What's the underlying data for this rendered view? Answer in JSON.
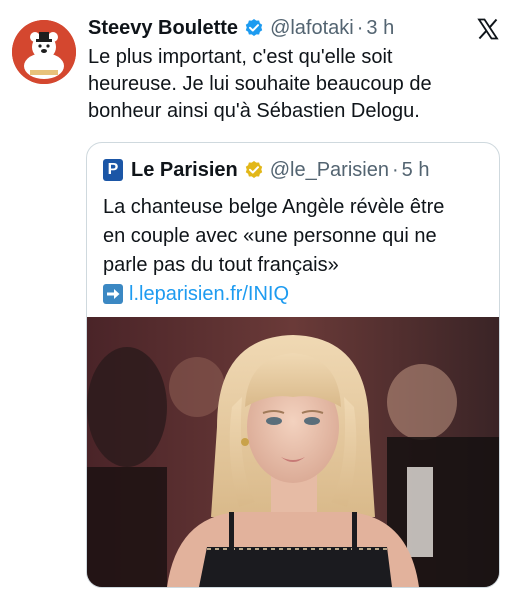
{
  "tweet": {
    "author_name": "Steevy Boulette",
    "handle": "@lafotaki",
    "separator": "·",
    "time": "3 h",
    "lines": [
      "Le plus important,  c'est qu'elle soit",
      "heureuse. Je lui souhaite beaucoup de",
      "bonheur ainsi qu'à Sébastien Delogu."
    ]
  },
  "quote": {
    "logo_letter": "P",
    "author_name": "Le Parisien",
    "handle": "@le_Parisien",
    "separator": "·",
    "time": "5 h",
    "lines": [
      "La chanteuse belge Angèle révèle être",
      "en couple avec «une personne qui ne",
      "parle pas du tout français»"
    ],
    "link": "l.leparisien.fr/INIQ"
  },
  "icons": {
    "verified": "verified-badge-icon",
    "gold_verified": "gold-verified-badge-icon",
    "x_logo": "x-logo-icon",
    "link_arrow": "right-arrow-emoji-icon"
  },
  "colors": {
    "text": "#0f1419",
    "secondary": "#536471",
    "link": "#1d9bf0",
    "verified_blue": "#1d9bf0",
    "gold": "#e2b719",
    "parisien_blue": "#1b56a6",
    "avatar_red": "#d4472f"
  }
}
